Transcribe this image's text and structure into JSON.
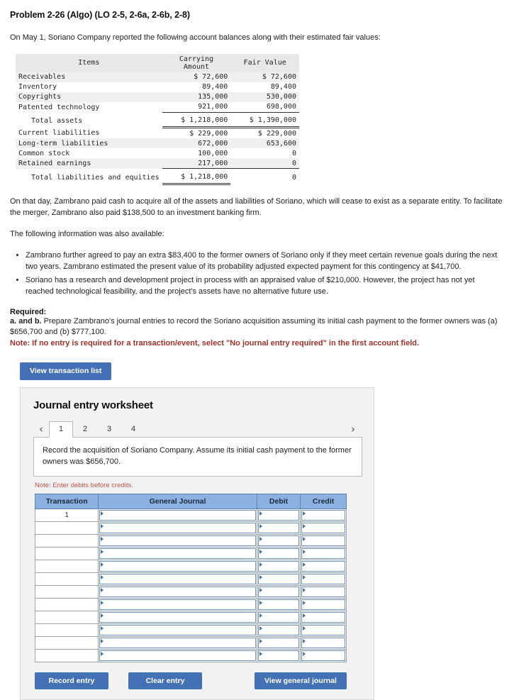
{
  "problem": {
    "title": "Problem 2-26 (Algo) (LO 2-5, 2-6a, 2-6b, 2-8)",
    "intro": "On May 1, Soriano Company reported the following account balances along with their estimated fair values:",
    "paragraph_merger": "On that day, Zambrano paid cash to acquire all of the assets and liabilities of Soriano, which will cease to exist as a separate entity. To facilitate the merger, Zambrano also paid $138,500 to an investment banking firm.",
    "paragraph_available": "The following information was also available:",
    "bullets": [
      "Zambrano further agreed to pay an extra $83,400 to the former owners of Soriano only if they meet certain revenue goals during the next two years. Zambrano estimated the present value of its probability adjusted expected payment for this contingency at $41,700.",
      "Soriano has a research and development project in process with an appraised value of $210,000. However, the project has not yet reached technological feasibility, and the project's assets have no alternative future use."
    ],
    "required_label": "Required:",
    "required_text_prefix": "a. and b.",
    "required_text": " Prepare Zambrano's journal entries to record the Soriano acquisition assuming its initial cash payment to the former owners was (a) $656,700 and (b) $777,100.",
    "note_red": "Note: If no entry is required for a transaction/event, select \"No journal entry required\" in the first account field."
  },
  "balance_table": {
    "headers": [
      "Items",
      "Carrying Amount",
      "Fair Value"
    ],
    "rows": [
      {
        "item": "Receivables",
        "carrying": "$ 72,600",
        "fair": "$ 72,600",
        "indent": false,
        "underline": "none"
      },
      {
        "item": "Inventory",
        "carrying": "89,400",
        "fair": "89,400",
        "indent": false,
        "underline": "none"
      },
      {
        "item": "Copyrights",
        "carrying": "135,000",
        "fair": "530,000",
        "indent": false,
        "underline": "none"
      },
      {
        "item": "Patented technology",
        "carrying": "921,000",
        "fair": "698,000",
        "indent": false,
        "underline": "single"
      },
      {
        "item": "Total assets",
        "carrying": "$ 1,218,000",
        "fair": "$ 1,390,000",
        "indent": true,
        "underline": "double"
      },
      {
        "item": "Current liabilities",
        "carrying": "$ 229,000",
        "fair": "$ 229,000",
        "indent": false,
        "underline": "none"
      },
      {
        "item": "Long-term liabilities",
        "carrying": "672,000",
        "fair": "653,600",
        "indent": false,
        "underline": "none"
      },
      {
        "item": "Common stock",
        "carrying": "100,000",
        "fair": "0",
        "indent": false,
        "underline": "none"
      },
      {
        "item": "Retained earnings",
        "carrying": "217,000",
        "fair": "0",
        "indent": false,
        "underline": "single"
      },
      {
        "item": "Total liabilities and equities",
        "carrying": "$ 1,218,000",
        "fair": "0",
        "indent": true,
        "underline": "double"
      }
    ]
  },
  "toolbar": {
    "view_transaction_list": "View transaction list"
  },
  "worksheet": {
    "title": "Journal entry worksheet",
    "prev_arrow": "‹",
    "next_arrow": "›",
    "tabs": [
      "1",
      "2",
      "3",
      "4"
    ],
    "active_tab": "1",
    "instruction": "Record the acquisition of Soriano Company. Assume its initial cash payment to the former owners was $656,700.",
    "debit_note": "Note: Enter debits before credits.",
    "columns": [
      "Transaction",
      "General Journal",
      "Debit",
      "Credit"
    ],
    "rows": [
      {
        "transaction": "1"
      },
      {
        "transaction": ""
      },
      {
        "transaction": ""
      },
      {
        "transaction": ""
      },
      {
        "transaction": ""
      },
      {
        "transaction": ""
      },
      {
        "transaction": ""
      },
      {
        "transaction": ""
      },
      {
        "transaction": ""
      },
      {
        "transaction": ""
      },
      {
        "transaction": ""
      },
      {
        "transaction": ""
      }
    ],
    "buttons": {
      "record": "Record entry",
      "clear": "Clear entry",
      "view_general_journal": "View general journal"
    }
  },
  "colors": {
    "button_blue": "#4471b5",
    "table_header_blue": "#8cb0e0",
    "note_red": "#a23129",
    "debit_note_red": "#c2544b",
    "panel_gray": "#f2f2f2"
  }
}
